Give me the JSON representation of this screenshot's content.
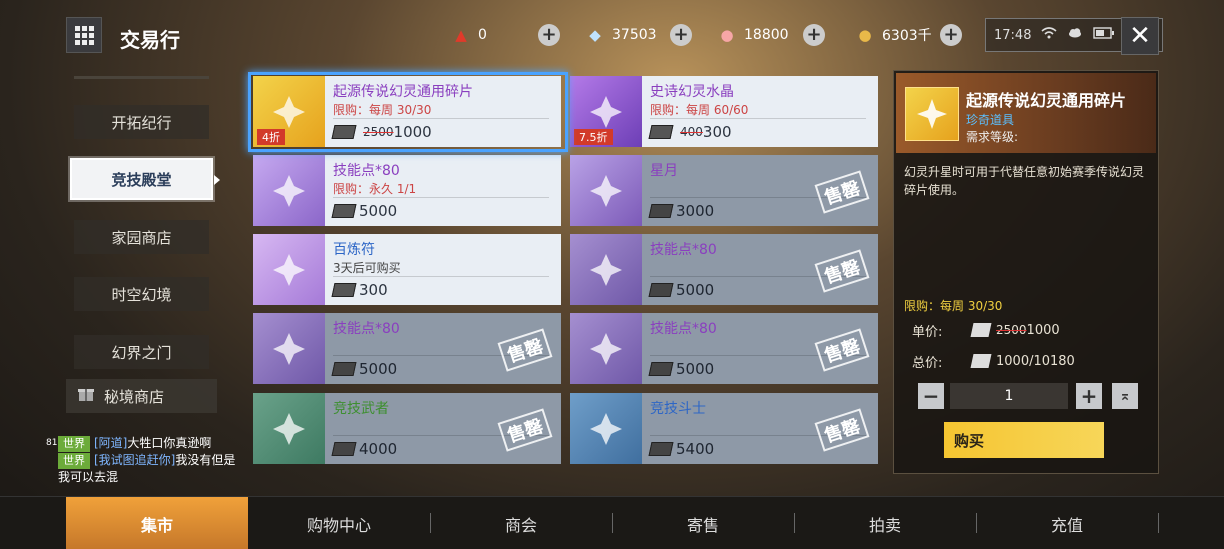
{
  "header": {
    "title": "交易行",
    "currencies": [
      {
        "icon": "red-crystal-icon",
        "value": "0"
      },
      {
        "icon": "diamond-icon",
        "value": "37503"
      },
      {
        "icon": "shell-icon",
        "value": "18800"
      },
      {
        "icon": "gold-coin-icon",
        "value": "6303千"
      }
    ],
    "time": "17:48",
    "plus": "+"
  },
  "sidebar": {
    "items": [
      {
        "label": "开拓纪行"
      },
      {
        "label": "竞技殿堂"
      },
      {
        "label": "家园商店"
      },
      {
        "label": "时空幻境"
      },
      {
        "label": "幻界之门"
      },
      {
        "label": "秘境商店"
      }
    ]
  },
  "chat": {
    "level": "81",
    "lines": [
      {
        "tag": "世界",
        "name": "[阿道]",
        "text": "大牲口你真逊啊"
      },
      {
        "tag": "世界",
        "name": "[我试图追赶你]",
        "text": "我没有但是我可以去混"
      }
    ]
  },
  "items": [
    {
      "name": "起源传说幻灵通用碎片",
      "limit": "限购：每周 30/30",
      "old_price": "2500",
      "price": "1000",
      "discount": "4折",
      "color": "purple",
      "sold": false
    },
    {
      "name": "史诗幻灵水晶",
      "limit": "限购：每周 60/60",
      "old_price": "400",
      "price": "300",
      "discount": "7.5折",
      "color": "purple",
      "sold": false
    },
    {
      "name": "技能点*80",
      "limit": "限购：永久 1/1",
      "old_price": "",
      "price": "5000",
      "discount": "",
      "color": "purple",
      "sold": false
    },
    {
      "name": "星月",
      "limit": "",
      "old_price": "",
      "price": "3000",
      "discount": "",
      "color": "purple",
      "sold": true
    },
    {
      "name": "百炼符",
      "limit": "3天后可购买",
      "old_price": "",
      "price": "300",
      "discount": "",
      "color": "blue",
      "sold": false
    },
    {
      "name": "技能点*80",
      "limit": "",
      "old_price": "",
      "price": "5000",
      "discount": "",
      "color": "purple",
      "sold": true
    },
    {
      "name": "技能点*80",
      "limit": "",
      "old_price": "",
      "price": "5000",
      "discount": "",
      "color": "purple",
      "sold": true
    },
    {
      "name": "技能点*80",
      "limit": "",
      "old_price": "",
      "price": "5000",
      "discount": "",
      "color": "purple",
      "sold": true
    },
    {
      "name": "竞技武者",
      "limit": "",
      "old_price": "",
      "price": "4000",
      "discount": "",
      "color": "green",
      "sold": true
    },
    {
      "name": "竞技斗士",
      "limit": "",
      "old_price": "",
      "price": "5400",
      "discount": "",
      "color": "blue",
      "sold": true
    }
  ],
  "sold_label": "售罄",
  "detail": {
    "name": "起源传说幻灵通用碎片",
    "type": "珍奇道具",
    "req": "需求等级:",
    "desc": "幻灵升星时可用于代替任意初始赛季传说幻灵碎片使用。",
    "limit": "限购：每周 30/30",
    "unit_label": "单价:",
    "unit_old": "2500",
    "unit_price": "1000",
    "total_label": "总价:",
    "total": "1000/10180",
    "qty": "1",
    "buy": "购买"
  },
  "tabs": [
    {
      "label": "集市"
    },
    {
      "label": "购物中心"
    },
    {
      "label": "商会"
    },
    {
      "label": "寄售"
    },
    {
      "label": "拍卖"
    },
    {
      "label": "充值"
    }
  ]
}
